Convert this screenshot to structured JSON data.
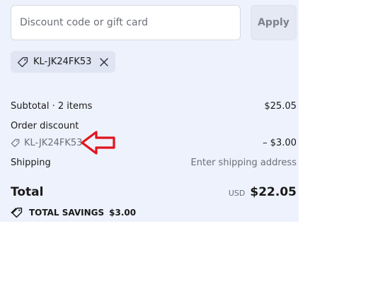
{
  "discount": {
    "placeholder": "Discount code or gift card",
    "apply_label": "Apply",
    "applied_code": "KL-JK24FK53"
  },
  "summary": {
    "subtotal_label": "Subtotal · 2 items",
    "subtotal_value": "$25.05",
    "order_discount_label": "Order discount",
    "discount_code": "KL-JK24FK53",
    "discount_value": "– $3.00",
    "shipping_label": "Shipping",
    "shipping_value": "Enter shipping address",
    "total_label": "Total",
    "currency": "USD",
    "total_value": "$22.05",
    "savings_label": "TOTAL SAVINGS",
    "savings_value": "$3.00"
  },
  "annotation": {
    "arrow_color": "#e0141e",
    "arrow_direction": "left"
  },
  "icons": {
    "tag": "tag-icon",
    "remove": "close-icon",
    "savings": "tags-icon"
  }
}
